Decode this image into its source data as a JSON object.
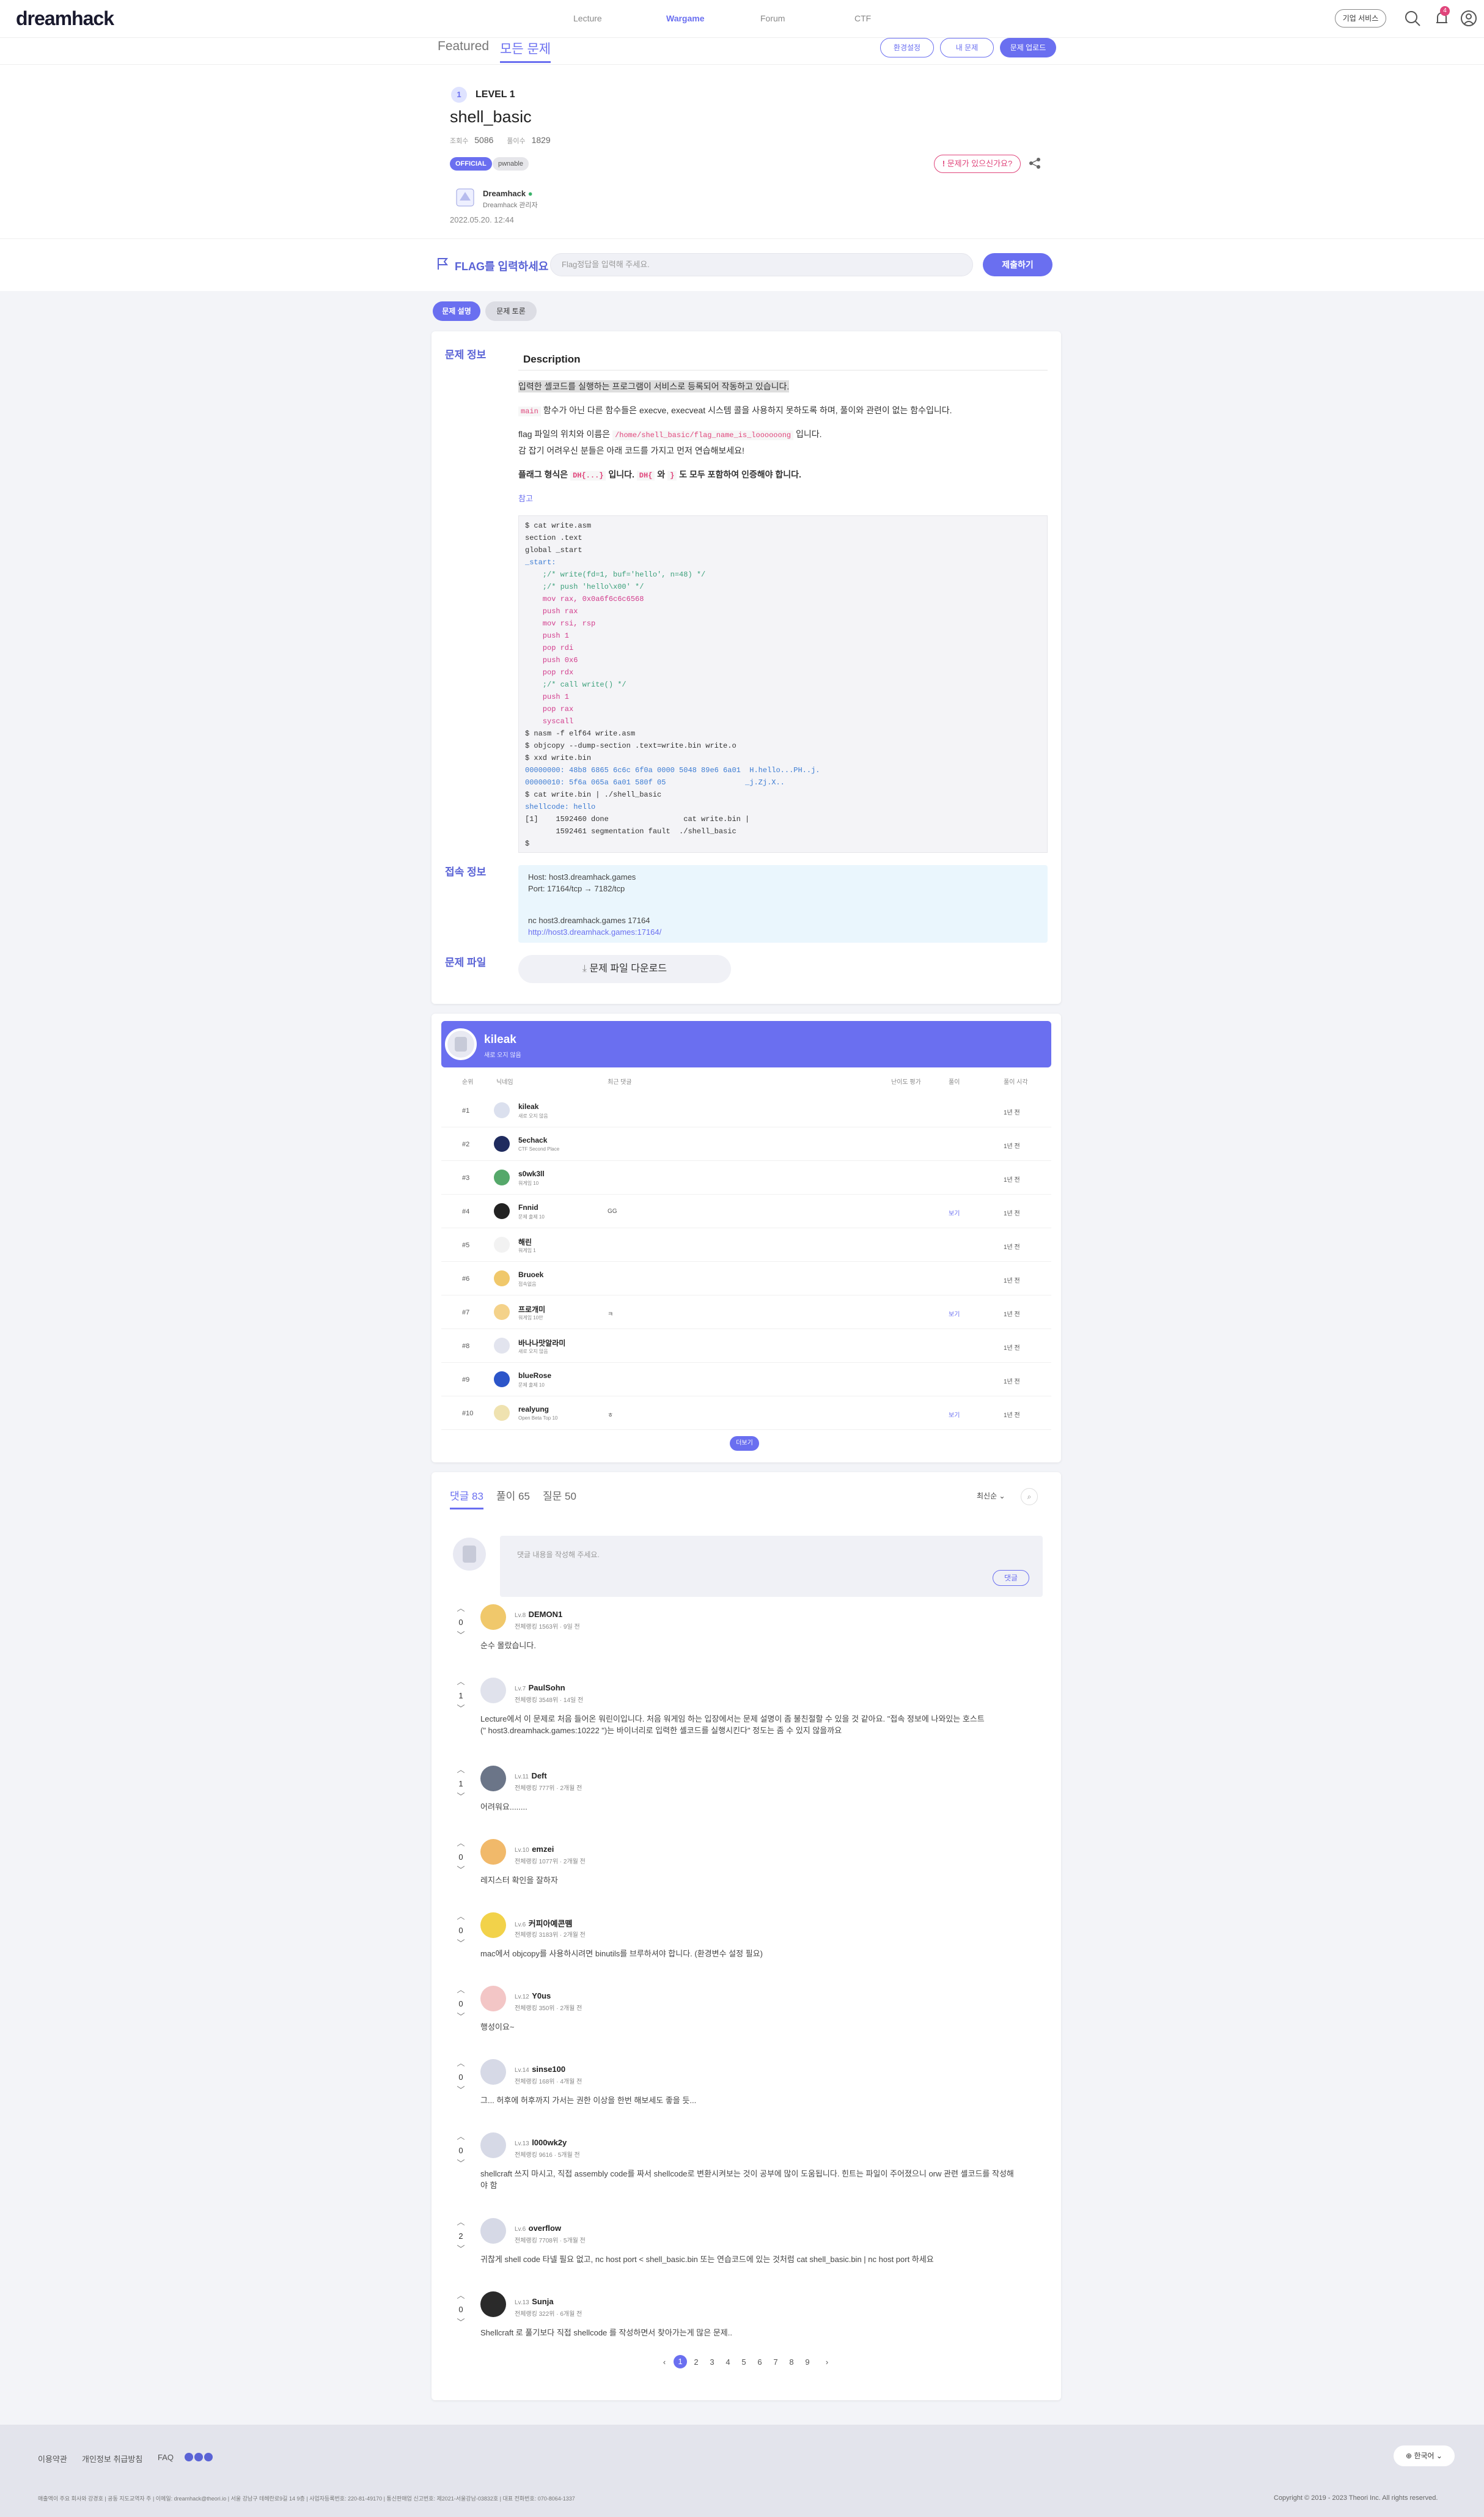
{
  "nav": {
    "logo": "dreamhack",
    "links": [
      "Lecture",
      "Wargame",
      "Forum",
      "CTF"
    ],
    "corp_button": "기업 서비스",
    "notif_count": "4"
  },
  "subnav": {
    "tabs": [
      "Featured",
      "모든 문제"
    ],
    "env_button": "환경설정",
    "my_button": "내 문제",
    "upload_button": "문제 업로드"
  },
  "challenge": {
    "level": "LEVEL 1",
    "level_num": "1",
    "title": "shell_basic",
    "views_label": "조회수",
    "views": "5086",
    "solves_label": "풀이수",
    "solves": "1829",
    "badge_official": "OFFICIAL",
    "badge_tag": "pwnable",
    "report": "문제가 있으신가요?",
    "author": "Dreamhack",
    "author_sub": "Dreamhack 관리자",
    "date": "2022.05.20. 12:44"
  },
  "flag": {
    "label": "FLAG를 입력하세요",
    "placeholder": "Flag정답을 입력해 주세요.",
    "submit": "제출하기"
  },
  "problem_tabs": [
    "문제 설명",
    "문제 토론"
  ],
  "sections": {
    "info_label": "문제 정보",
    "conn_label": "접속 정보",
    "file_label": "문제 파일",
    "description_title": "Description",
    "p1": "입력한 셸코드를 실행하는 프로그램이 서비스로 등록되어 작동하고 있습니다.",
    "p2_code": "main",
    "p2": "함수가 아닌 다른 함수들은 execve, execveat 시스템 콜을 사용하지 못하도록 하며, 풀이와 관련이 없는 함수입니다.",
    "p3_a": "flag 파일의 위치와 이름은",
    "p3_code": "/home/shell_basic/flag_name_is_loooooong",
    "p3_b": "입니다.",
    "p4": "감 잡기 어려우신 분들은 아래 코드를 가지고 먼저 연습해보세요!",
    "p5_a": "플래그 형식은",
    "p5_code1": "DH{...}",
    "p5_b": "입니다.",
    "p5_code2": "DH{",
    "p5_c": "와",
    "p5_code3": "}",
    "p5_d": "도 모두 포함하여 인증해야 합니다.",
    "ref": "참고",
    "host_line": "Host: host3.dreamhack.games",
    "port_line": "Port: 17164/tcp → 7182/tcp",
    "nc_line": "nc host3.dreamhack.games 17164",
    "http_line": "http://host3.dreamhack.games:17164/",
    "download": "문제 파일 다운로드"
  },
  "code": {
    "l1": "$ cat write.asm",
    "l2": "section .text",
    "l3": "global _start",
    "l4": "_start:",
    "l5": "    ;/* write(fd=1, buf='hello', n=48) */",
    "l6": "    ;/* push 'hello\\x00' */",
    "l7": "    mov rax, 0x0a6f6c6c6568",
    "l8": "    push rax",
    "l9": "    mov rsi, rsp",
    "l10": "    push 1",
    "l11": "    pop rdi",
    "l12": "    push 0x6",
    "l13": "    pop rdx",
    "l14": "    ;/* call write() */",
    "l15": "    push 1",
    "l16": "    pop rax",
    "l17": "    syscall",
    "l18": "$ nasm -f elf64 write.asm",
    "l19": "$ objcopy --dump-section .text=write.bin write.o",
    "l20": "$ xxd write.bin",
    "l21": "00000000: 48b8 6865 6c6c 6f0a 0000 5048 89e6 6a01  H.hello...PH..j.",
    "l22": "00000010: 5f6a 065a 6a01 580f 05                  _j.Zj.X..",
    "l23": "$ cat write.bin | ./shell_basic",
    "l24": "shellcode: hello",
    "l25": "[1]    1592460 done                 cat write.bin |",
    "l26": "       1592461 segmentation fault  ./shell_basic",
    "l27": "$"
  },
  "ranking": {
    "leader_name": "kileak",
    "leader_sub": "새로 오지 않음",
    "headers": [
      "순위",
      "닉네임",
      "최근 댓글",
      "난이도 평가",
      "풀이",
      "풀이 시각"
    ],
    "rows": [
      {
        "rank": "#1",
        "name": "kileak",
        "sub": "새로 오지 않음",
        "comment": "",
        "link": "",
        "time": "1년 전"
      },
      {
        "rank": "#2",
        "name": "5echack",
        "sub": "CTF Second Place",
        "comment": "",
        "link": "",
        "time": "1년 전"
      },
      {
        "rank": "#3",
        "name": "s0wk3ll",
        "sub": "워게임 10",
        "comment": "",
        "link": "",
        "time": "1년 전"
      },
      {
        "rank": "#4",
        "name": "Fnnid",
        "sub": "문제 출제 10",
        "comment": "GG",
        "link": "보기",
        "time": "1년 전"
      },
      {
        "rank": "#5",
        "name": "해린",
        "sub": "워게임 1",
        "comment": "",
        "link": "",
        "time": "1년 전"
      },
      {
        "rank": "#6",
        "name": "Bruoek",
        "sub": "접속없음",
        "comment": "",
        "link": "",
        "time": "1년 전"
      },
      {
        "rank": "#7",
        "name": "프로개미",
        "sub": "워게임 10만",
        "comment": "ㅋ",
        "link": "보기",
        "time": "1년 전"
      },
      {
        "rank": "#8",
        "name": "바나나맛알라미",
        "sub": "새로 오지 않음",
        "comment": "",
        "link": "",
        "time": "1년 전"
      },
      {
        "rank": "#9",
        "name": "blueRose",
        "sub": "문제 출제 10",
        "comment": "",
        "link": "",
        "time": "1년 전"
      },
      {
        "rank": "#10",
        "name": "realyung",
        "sub": "Open Beta Top 10",
        "comment": "ㅎ",
        "link": "보기",
        "time": "1년 전"
      }
    ],
    "more": "더보기"
  },
  "comments": {
    "tabs": [
      "댓글 83",
      "풀이 65",
      "질문 50"
    ],
    "sort": "최신순",
    "placeholder": "댓글 내용을 작성해 주세요.",
    "submit": "댓글",
    "items": [
      {
        "votes": "0",
        "lv": "Lv.8",
        "name": "DEMON1",
        "sub": "전체랭킹 1563위 · 9일 전",
        "text": "순수 몰랐습니다."
      },
      {
        "votes": "1",
        "lv": "Lv.7",
        "name": "PaulSohn",
        "sub": "전체랭킹 3548위 · 14일 전",
        "text": "Lecture에서 이 문제로 처음 들어온 워린이입니다. 처음 워게임 하는 입장에서는 문제 설명이 좀 불친절할 수 있을 것 같아요. \"접속 정보에 나와있는 호스트",
        "text2": "(\" host3.dreamhack.games:10222 \")는 바이너리로 입력한 셸코드를 실행시킨다\" 정도는 좀 수 있지 않을까요"
      },
      {
        "votes": "1",
        "lv": "Lv.11",
        "name": "Deft",
        "sub": "전체랭킹 777위 · 2개월 전",
        "text": "어려워요........"
      },
      {
        "votes": "0",
        "lv": "Lv.10",
        "name": "emzei",
        "sub": "전체랭킹 1077위 · 2개월 전",
        "text": "레지스터 확인을 잘하자"
      },
      {
        "votes": "0",
        "lv": "Lv.6",
        "name": "커피아예콘뗌",
        "sub": "전체랭킹 3183위 · 2개월 전",
        "text": "mac에서 objcopy를 사용하시려면 binutils를 브루하셔야 합니다. (환경변수 설정 필요)"
      },
      {
        "votes": "0",
        "lv": "Lv.12",
        "name": "Y0us",
        "sub": "전체랭킹 350위 · 2개월 전",
        "text": "행성이요~"
      },
      {
        "votes": "0",
        "lv": "Lv.14",
        "name": "sinse100",
        "sub": "전체랭킹 168위 · 4개월 전",
        "text": "그... 허후에 허후까지 가서는 권한 이상을 한번 해보세도 좋을 듯..."
      },
      {
        "votes": "0",
        "lv": "Lv.13",
        "name": "l000wk2y",
        "sub": "전체랭킹 9616 · 5개월 전",
        "text": "shellcraft 쓰지 마시고, 직접 assembly code를 짜서 shellcode로 변환시켜보는 것이 공부에 많이 도움됩니다. 힌트는 파일이 주어졌으니 orw 관련 셸코드를 작성해",
        "text2": "야 함"
      },
      {
        "votes": "2",
        "lv": "Lv.6",
        "name": "overflow",
        "sub": "전체랭킹 7708위 · 5개월 전",
        "text": "귀찮게 shell code 타넬 필요 없고, nc host port < shell_basic.bin 또는 연습코드에 있는 것처럼 cat shell_basic.bin | nc host port 하세요"
      },
      {
        "votes": "0",
        "lv": "Lv.13",
        "name": "Sunja",
        "sub": "전체랭킹 322위 · 6개월 전",
        "text": "Shellcraft 로 풀기보다 직접 shellcode 를 작성하면서 찾아가는게 많은 문제.."
      }
    ],
    "pages": [
      "1",
      "2",
      "3",
      "4",
      "5",
      "6",
      "7",
      "8",
      "9"
    ]
  },
  "footer": {
    "links": [
      "이용약관",
      "개인정보 취급방침",
      "FAQ"
    ],
    "lang": "한국어",
    "info": "매출액이 주요 회사와 강경호 | 공동 지도교역자 주 | 이메일: dreamhack@theori.io | 서울 강남구 테헤란로9길 14 9층 | 사업자등록번호: 220-81-49170 | 통신판매업 신고번호: 제2021-서울강남-03832호 | 대표 전화번호: 070-8064-1337",
    "copyright": "Copyright © 2019 - 2023 Theori Inc. All rights reserved."
  }
}
